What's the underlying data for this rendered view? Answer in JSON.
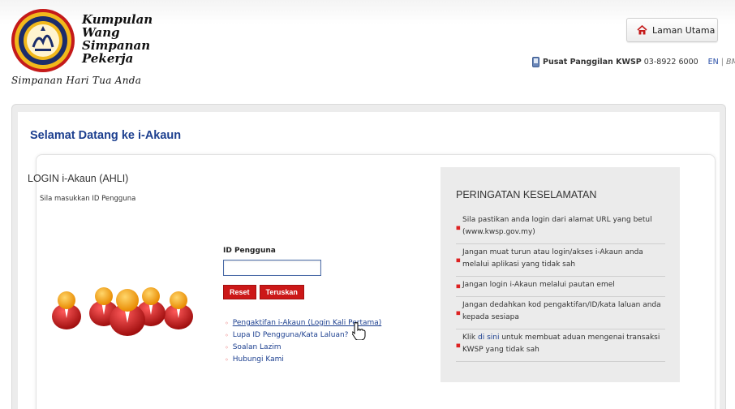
{
  "brand": {
    "line1": "Kumpulan",
    "line2": "Wang",
    "line3": "Simpanan",
    "line4": "Pekerja",
    "tagline": "Simpanan Hari Tua Anda"
  },
  "header": {
    "home_label": "Laman Utama",
    "call_label": "Pusat Panggilan KWSP",
    "call_number": "03-8922 6000",
    "lang_en": "EN",
    "lang_bm": "BM",
    "lang_sep": "|"
  },
  "page": {
    "welcome": "Selamat Datang ke i-Akaun"
  },
  "login": {
    "title": "LOGIN i-Akaun (AHLI)",
    "subtitle": "Sila masukkan ID Pengguna",
    "id_label": "ID Pengguna",
    "id_value": "",
    "reset_label": "Reset",
    "submit_label": "Teruskan",
    "links": [
      "Pengaktifan i-Akaun (Login Kali Pertama)",
      "Lupa ID Pengguna/Kata Laluan?",
      "Soalan Lazim",
      "Hubungi Kami"
    ]
  },
  "security": {
    "title": "PERINGATAN KESELAMATAN",
    "items": [
      "Sila pastikan anda login dari alamat URL yang betul (www.kwsp.gov.my)",
      "Jangan muat turun atau login/akses i-Akaun anda melalui aplikasi yang tidak sah",
      "Jangan login i-Akaun melalui pautan emel",
      "Jangan dedahkan kod pengaktifan/ID/kata laluan anda kepada sesiapa"
    ],
    "last_prefix": "Klik",
    "last_link": "di sini",
    "last_suffix": "untuk membuat aduan mengenai transaksi KWSP yang tidak sah"
  },
  "colors": {
    "brand_blue": "#1c3f8f",
    "button_red": "#cc1818",
    "accent_orange": "#f4a20f"
  },
  "icons": {
    "home": "house-icon",
    "phone": "mobile-phone-icon",
    "cursor": "hand-pointer-icon",
    "logo": "kwsp-seal-icon"
  }
}
